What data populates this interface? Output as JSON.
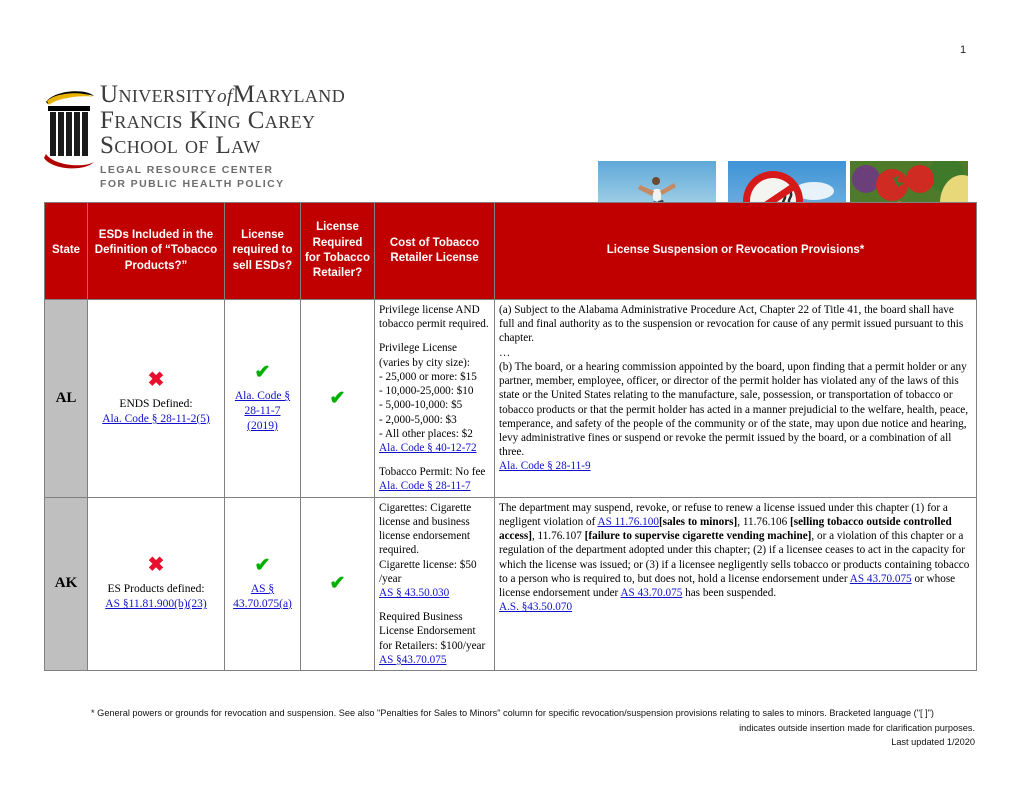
{
  "page_number": "1",
  "logo": {
    "line1_a": "U",
    "line1_b": "NIVERSITY",
    "line1_of": "of",
    "line1_c": "M",
    "line1_d": "ARYLAND",
    "line2_a": "F",
    "line2_b": "RANCIS",
    "line2_c": "K",
    "line2_d": "ING",
    "line2_e": "C",
    "line2_f": "AREY",
    "line3_a": "S",
    "line3_b": "CHOOL",
    "line3_c": "OF",
    "line3_d": "L",
    "line3_e": "AW",
    "line4": "LEGAL RESOURCE CENTER",
    "line5": "FOR PUBLIC HEALTH POLICY"
  },
  "photos": [
    {
      "name": "beach-runner-photo",
      "alt": "Woman running on beach"
    },
    {
      "name": "no-smoking-sign-photo",
      "alt": "No smoking sign against sky"
    },
    {
      "name": "vegetables-photo",
      "alt": "Fresh vegetables"
    }
  ],
  "table": {
    "headers": [
      "State",
      "ESDs Included in the Definition of “Tobacco Products?”",
      "License required to sell ESDs?",
      "License Required for Tobacco Retailer?",
      "Cost of Tobacco Retailer License",
      "License Suspension or Revocation Provisions*"
    ],
    "rows": [
      {
        "state": "AL",
        "esd": {
          "mark": "✖",
          "mark_type": "x",
          "note": "ENDS Defined:",
          "link": "Ala. Code § 28-11-2(5)"
        },
        "license_esd": {
          "mark": "✔",
          "mark_type": "check",
          "link": "Ala. Code § 28-11-7 (2019)"
        },
        "license_retailer": {
          "mark": "✔",
          "mark_type": "check"
        },
        "cost": {
          "p1": "Privilege license AND tobacco permit required.",
          "p2_head": "Privilege License (varies by city size):",
          "p2_items": [
            "- 25,000 or more: $15",
            "- 10,000-25,000: $10",
            "- 5,000-10,000: $5",
            "- 2,000-5,000: $3",
            "- All other places: $2"
          ],
          "p2_link": "Ala. Code § 40-12-72",
          "p3": "Tobacco Permit: No fee",
          "p3_link": "Ala. Code § 28-11-7"
        },
        "provisions": {
          "a": "(a) Subject to the Alabama Administrative Procedure Act, Chapter 22 of Title 41, the board shall have full and final authority as to the suspension or revocation for cause of any permit issued pursuant to this chapter.",
          "ellipsis": "…",
          "b": "(b) The board, or a hearing commission appointed by the board, upon finding that a permit holder or any partner, member, employee, officer, or director of the permit holder has violated any of the laws of this state or the United States relating to the manufacture, sale, possession, or transportation of tobacco or tobacco products or that the permit holder has acted in a manner prejudicial to the welfare, health, peace, temperance, and safety of the people of the community or of the state, may upon due notice and hearing, levy administrative fines or suspend or revoke the permit issued by the board, or a combination of all three.",
          "link": "Ala. Code § 28-11-9"
        }
      },
      {
        "state": "AK",
        "esd": {
          "mark": "✖",
          "mark_type": "x",
          "note": "ES Products defined:",
          "link": "AS §11.81.900(b)(23)"
        },
        "license_esd": {
          "mark": "✔",
          "mark_type": "check",
          "link": "AS § 43.70.075(a)"
        },
        "license_retailer": {
          "mark": "✔",
          "mark_type": "check"
        },
        "cost": {
          "p1": "Cigarettes: Cigarette license and business license endorsement required.",
          "p2": "Cigarette license: $50 /year",
          "p2_link": "AS § 43.50.030",
          "p3": "Required Business License Endorsement for Retailers: $100/year",
          "p3_link": "AS §43.70.075"
        },
        "provisions": {
          "t1": "The department may suspend, revoke, or refuse to renew a license issued under this chapter (1) for a negligent violation of ",
          "link1": "AS 11.76.100",
          "ins1": "[sales to minors]",
          "t2": ", 11.76.106 ",
          "ins2": "[selling tobacco outside controlled access]",
          "t3": ", 11.76.107 ",
          "ins3": "[failure to supervise cigarette vending machine]",
          "t4": ", or a violation of this chapter or a regulation of the department adopted under this chapter; (2) if a licensee ceases to act in the capacity for which the license was issued; or (3) if a licensee negligently sells tobacco or products containing tobacco to a person who is required to, but does not, hold a license endorsement under ",
          "link2": "AS 43.70.075",
          "t5": " or whose license endorsement under ",
          "link3": "AS 43.70.075",
          "t6": " has been suspended.",
          "link4": "A.S. §43.50.070"
        }
      }
    ]
  },
  "footer": {
    "line1": "* General powers or grounds for revocation and suspension. See also \"Penalties for Sales to Minors\" column for specific revocation/suspension provisions relating to sales to minors. Bracketed language (\"[ ]\")",
    "line2": "indicates outside insertion made for clarification purposes.",
    "line3": "Last updated 1/2020"
  },
  "colors": {
    "header_red": "#C00000",
    "state_gray": "#BFBFBF",
    "link_blue": "#1111CC",
    "check_green": "#00B000",
    "x_red": "#E8112D"
  }
}
